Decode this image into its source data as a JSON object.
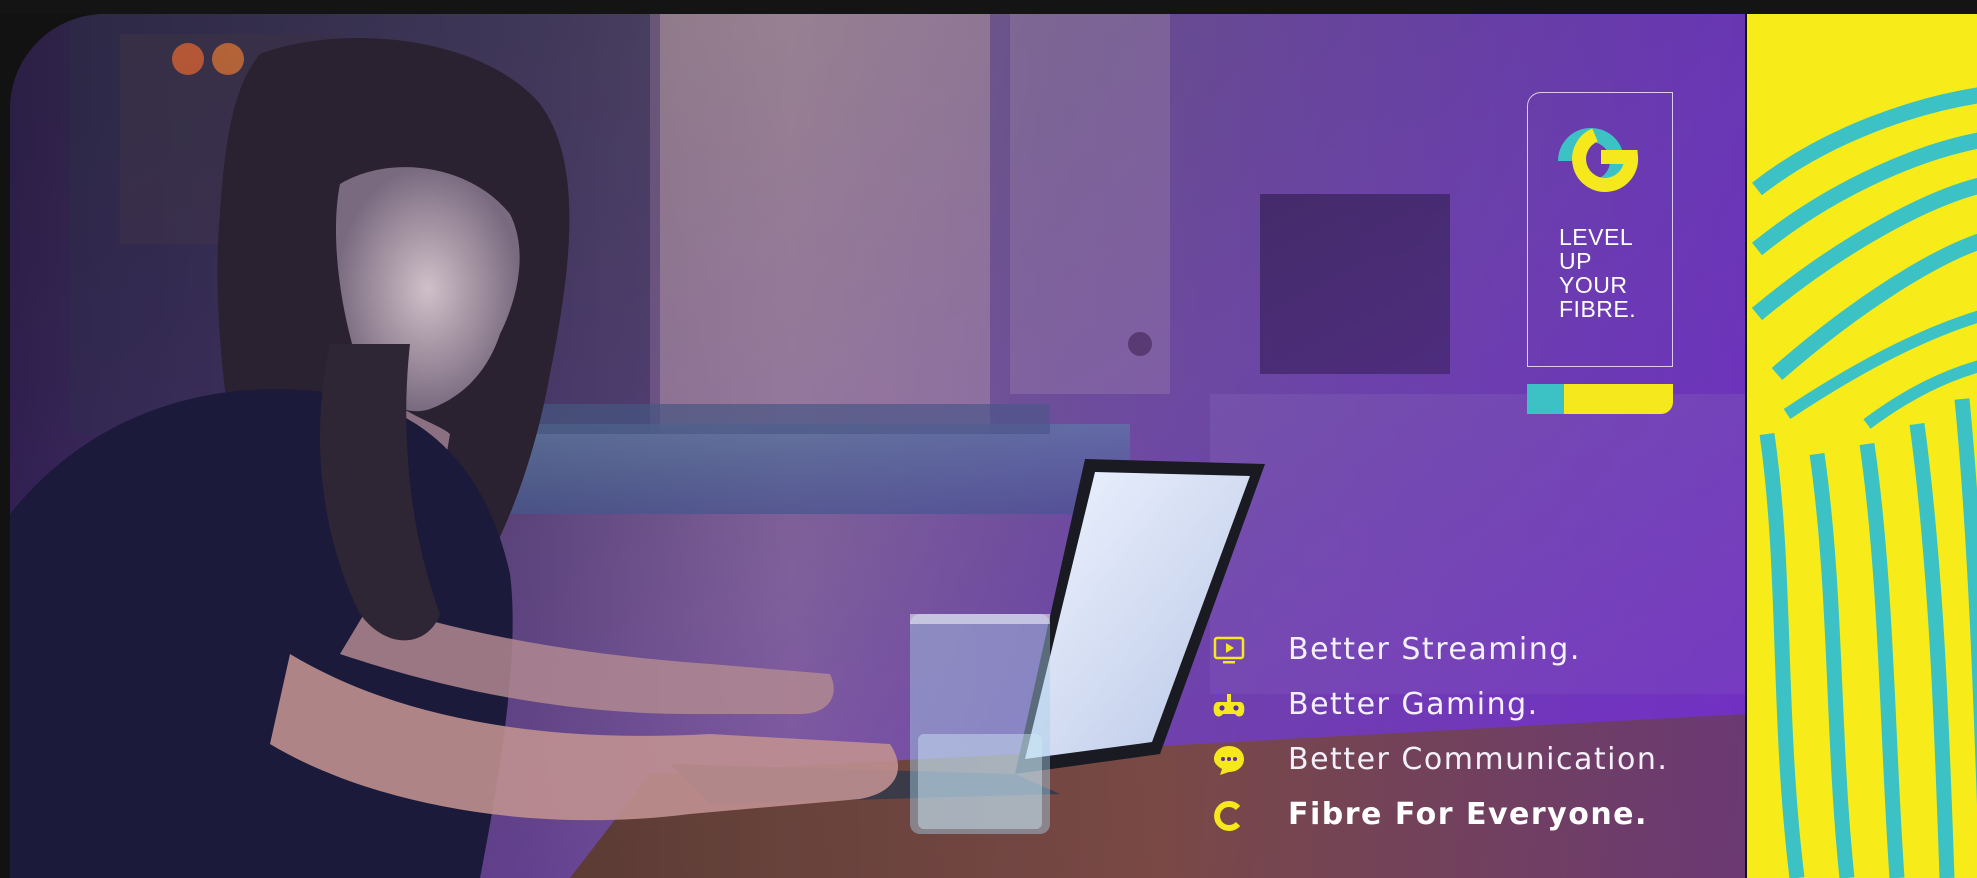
{
  "brand": {
    "tagline": [
      "LEVEL",
      "UP",
      "YOUR",
      "FIBRE."
    ],
    "logo_icon": "e-swirl-logo-icon",
    "level_fraction": 0.25
  },
  "features": [
    {
      "icon": "tv-play-icon",
      "label": "Better Streaming.",
      "strong": false
    },
    {
      "icon": "game-controller-icon",
      "label": "Better Gaming.",
      "strong": false
    },
    {
      "icon": "chat-bubble-icon",
      "label": "Better Communication.",
      "strong": false
    },
    {
      "icon": "c-arc-logo-icon",
      "label": "Fibre For Everyone.",
      "strong": true
    }
  ],
  "colors": {
    "accent_yellow": "#f5e81c",
    "accent_teal": "#3cc2c4",
    "deep_purple": "#5a2aa8",
    "frame_dark": "#141414"
  }
}
